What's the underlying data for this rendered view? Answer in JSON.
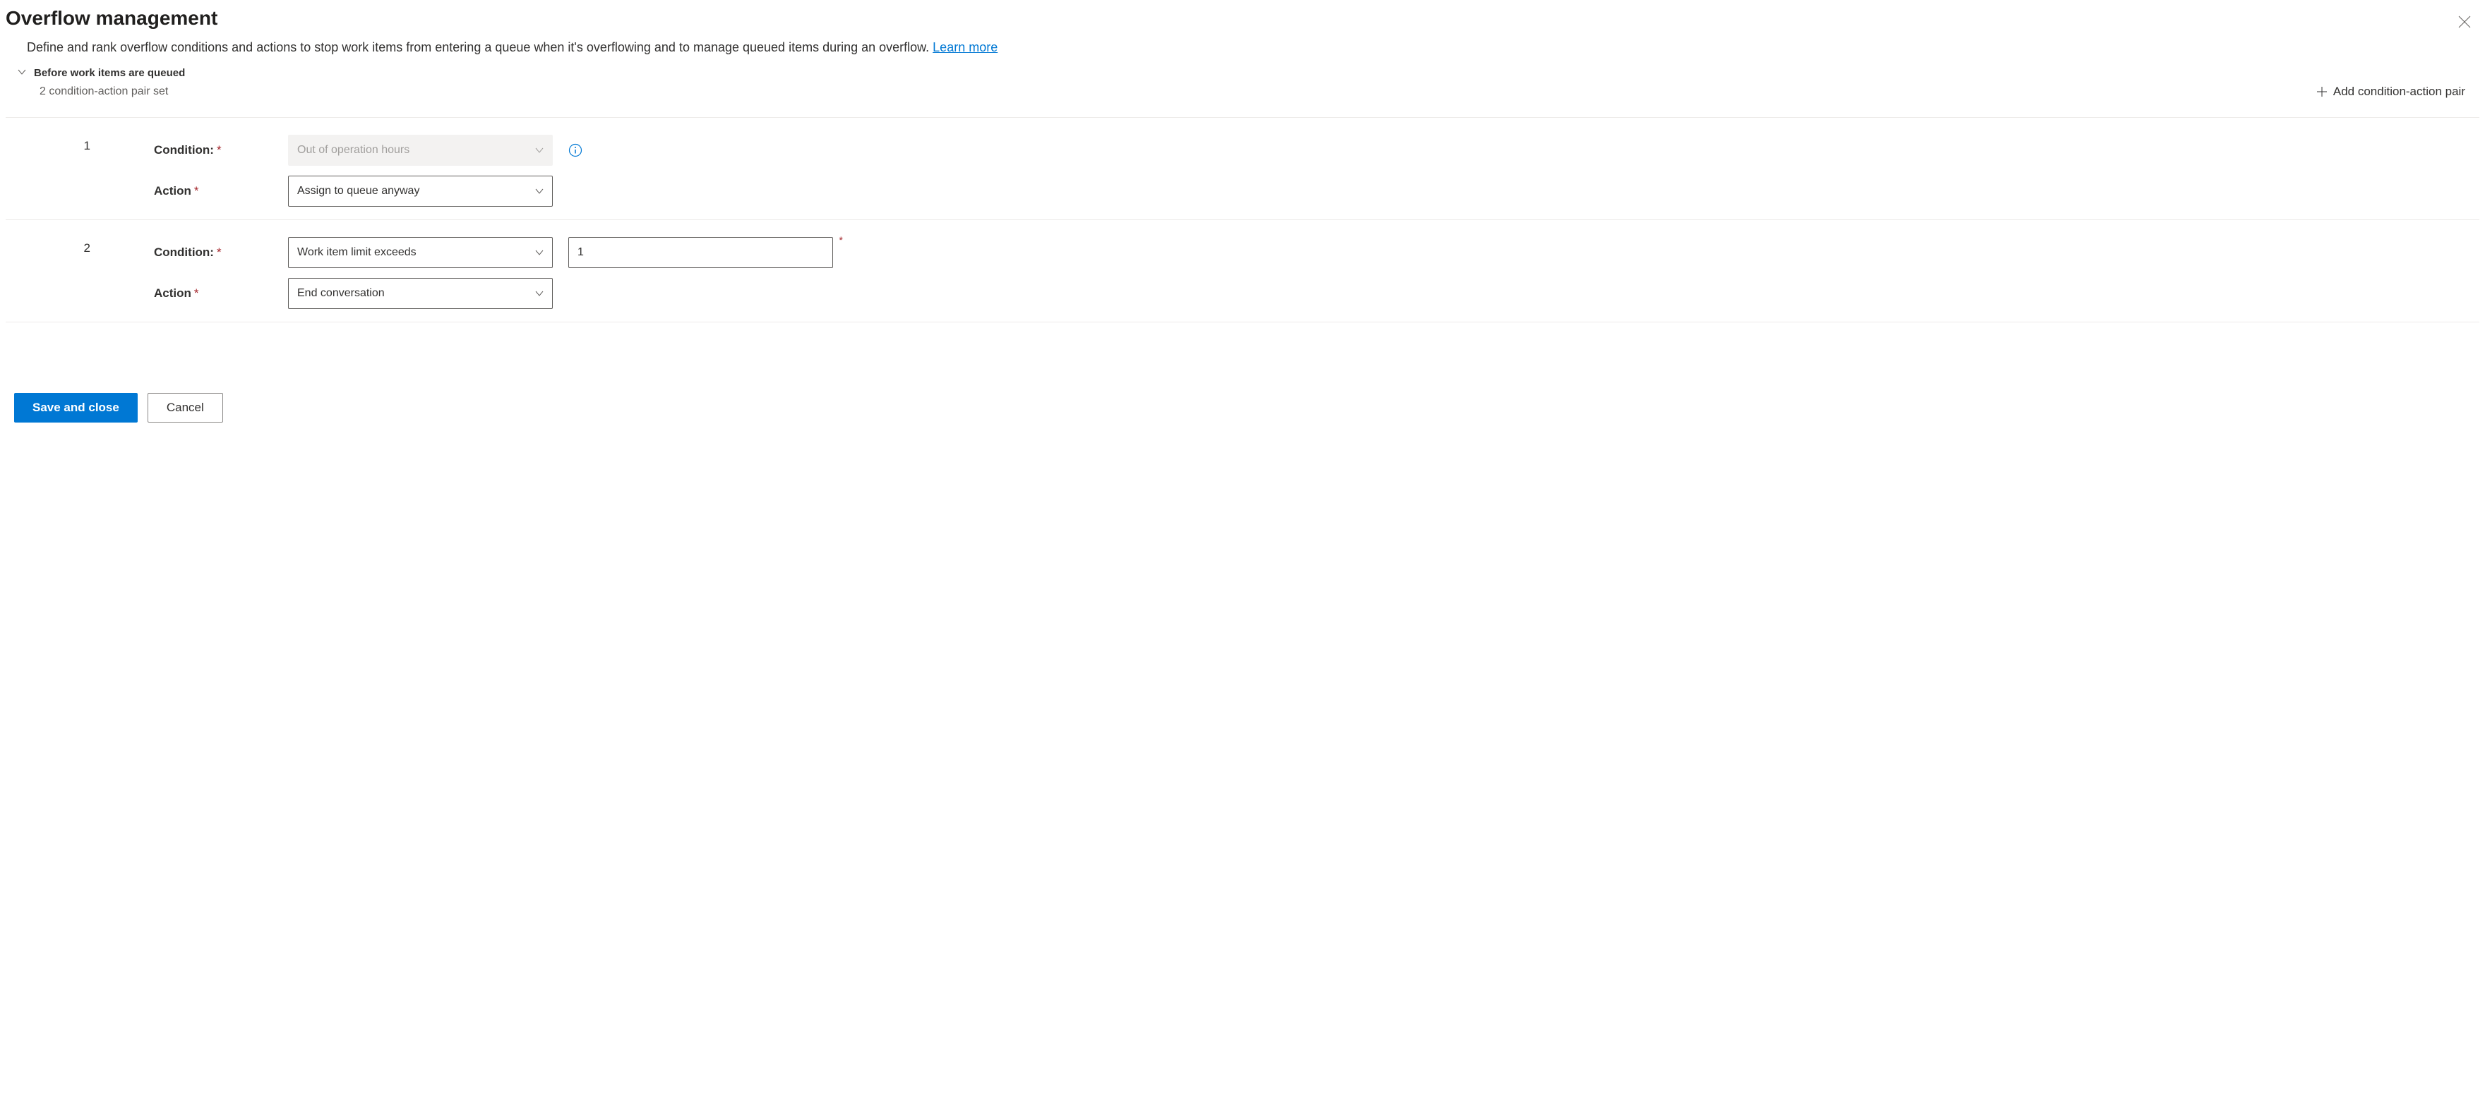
{
  "header": {
    "title": "Overflow management",
    "description_prefix": "Define and rank overflow conditions and actions to stop work items from entering a queue when it's overflowing and to manage queued items during an overflow. ",
    "learn_more": "Learn more"
  },
  "section": {
    "title": "Before work items are queued",
    "count_text": "2 condition-action pair set",
    "add_label": "Add condition-action pair"
  },
  "labels": {
    "condition": "Condition:",
    "action": "Action"
  },
  "pairs": [
    {
      "index": "1",
      "condition_value": "Out of operation hours",
      "condition_disabled": true,
      "action_value": "Assign to queue anyway",
      "has_info": true,
      "extra_input": null
    },
    {
      "index": "2",
      "condition_value": "Work item limit exceeds",
      "condition_disabled": false,
      "action_value": "End conversation",
      "has_info": false,
      "extra_input": "1"
    }
  ],
  "footer": {
    "save": "Save and close",
    "cancel": "Cancel"
  }
}
